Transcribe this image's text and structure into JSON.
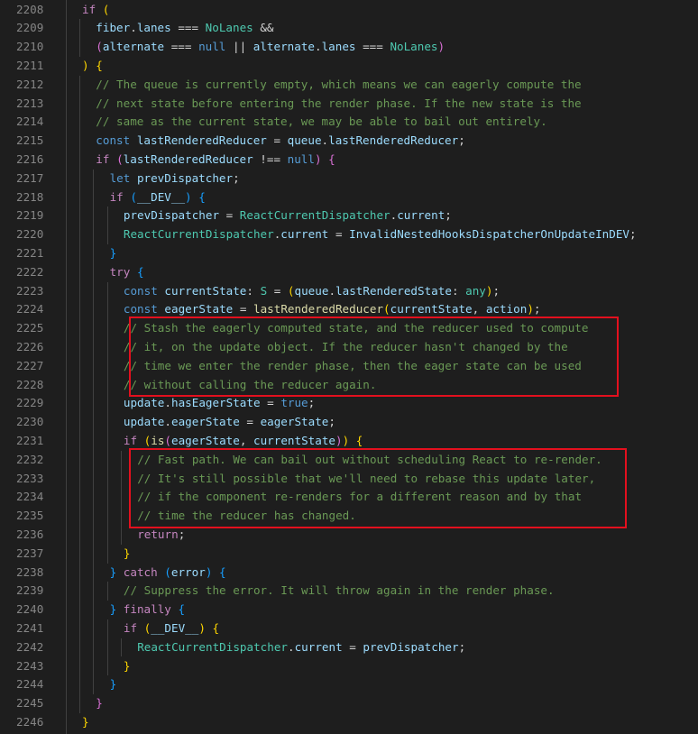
{
  "editor": {
    "colors": {
      "background": "#1e1e1e",
      "line_number": "#858585",
      "highlight_box": "#e3101e"
    },
    "highlight_boxes": [
      {
        "from_line": 2225,
        "to_line": 2228
      },
      {
        "from_line": 2232,
        "to_line": 2235
      }
    ],
    "lines": [
      {
        "n": "2208",
        "indent": 1,
        "tokens": [
          [
            "kw",
            "if"
          ],
          [
            "op",
            " "
          ],
          [
            "b1",
            "("
          ]
        ]
      },
      {
        "n": "2209",
        "indent": 2,
        "tokens": [
          [
            "var",
            "fiber"
          ],
          [
            "op",
            "."
          ],
          [
            "var",
            "lanes"
          ],
          [
            "op",
            " === "
          ],
          [
            "cls",
            "NoLanes"
          ],
          [
            "op",
            " &&"
          ]
        ]
      },
      {
        "n": "2210",
        "indent": 2,
        "tokens": [
          [
            "b2",
            "("
          ],
          [
            "var",
            "alternate"
          ],
          [
            "op",
            " === "
          ],
          [
            "st",
            "null"
          ],
          [
            "op",
            " || "
          ],
          [
            "var",
            "alternate"
          ],
          [
            "op",
            "."
          ],
          [
            "var",
            "lanes"
          ],
          [
            "op",
            " === "
          ],
          [
            "cls",
            "NoLanes"
          ],
          [
            "b2",
            ")"
          ]
        ]
      },
      {
        "n": "2211",
        "indent": 1,
        "tokens": [
          [
            "b1",
            ")"
          ],
          [
            "op",
            " "
          ],
          [
            "b1",
            "{"
          ]
        ]
      },
      {
        "n": "2212",
        "indent": 2,
        "tokens": [
          [
            "com",
            "// The queue is currently empty, which means we can eagerly compute the"
          ]
        ]
      },
      {
        "n": "2213",
        "indent": 2,
        "tokens": [
          [
            "com",
            "// next state before entering the render phase. If the new state is the"
          ]
        ]
      },
      {
        "n": "2214",
        "indent": 2,
        "tokens": [
          [
            "com",
            "// same as the current state, we may be able to bail out entirely."
          ]
        ]
      },
      {
        "n": "2215",
        "indent": 2,
        "tokens": [
          [
            "st",
            "const"
          ],
          [
            "op",
            " "
          ],
          [
            "var",
            "lastRenderedReducer"
          ],
          [
            "op",
            " = "
          ],
          [
            "var",
            "queue"
          ],
          [
            "op",
            "."
          ],
          [
            "var",
            "lastRenderedReducer"
          ],
          [
            "op",
            ";"
          ]
        ]
      },
      {
        "n": "2216",
        "indent": 2,
        "tokens": [
          [
            "kw",
            "if"
          ],
          [
            "op",
            " "
          ],
          [
            "b2",
            "("
          ],
          [
            "var",
            "lastRenderedReducer"
          ],
          [
            "op",
            " !== "
          ],
          [
            "st",
            "null"
          ],
          [
            "b2",
            ")"
          ],
          [
            "op",
            " "
          ],
          [
            "b2",
            "{"
          ]
        ]
      },
      {
        "n": "2217",
        "indent": 3,
        "tokens": [
          [
            "st",
            "let"
          ],
          [
            "op",
            " "
          ],
          [
            "var",
            "prevDispatcher"
          ],
          [
            "op",
            ";"
          ]
        ]
      },
      {
        "n": "2218",
        "indent": 3,
        "tokens": [
          [
            "kw",
            "if"
          ],
          [
            "op",
            " "
          ],
          [
            "b3",
            "("
          ],
          [
            "var",
            "__DEV__"
          ],
          [
            "b3",
            ")"
          ],
          [
            "op",
            " "
          ],
          [
            "b3",
            "{"
          ]
        ]
      },
      {
        "n": "2219",
        "indent": 4,
        "tokens": [
          [
            "var",
            "prevDispatcher"
          ],
          [
            "op",
            " = "
          ],
          [
            "cls",
            "ReactCurrentDispatcher"
          ],
          [
            "op",
            "."
          ],
          [
            "var",
            "current"
          ],
          [
            "op",
            ";"
          ]
        ]
      },
      {
        "n": "2220",
        "indent": 4,
        "tokens": [
          [
            "cls",
            "ReactCurrentDispatcher"
          ],
          [
            "op",
            "."
          ],
          [
            "var",
            "current"
          ],
          [
            "op",
            " = "
          ],
          [
            "var",
            "InvalidNestedHooksDispatcherOnUpdateInDEV"
          ],
          [
            "op",
            ";"
          ]
        ]
      },
      {
        "n": "2221",
        "indent": 3,
        "tokens": [
          [
            "b3",
            "}"
          ]
        ]
      },
      {
        "n": "2222",
        "indent": 3,
        "tokens": [
          [
            "kw",
            "try"
          ],
          [
            "op",
            " "
          ],
          [
            "b3",
            "{"
          ]
        ]
      },
      {
        "n": "2223",
        "indent": 4,
        "tokens": [
          [
            "st",
            "const"
          ],
          [
            "op",
            " "
          ],
          [
            "var",
            "currentState"
          ],
          [
            "op",
            ": "
          ],
          [
            "cls",
            "S"
          ],
          [
            "op",
            " = "
          ],
          [
            "b1",
            "("
          ],
          [
            "var",
            "queue"
          ],
          [
            "op",
            "."
          ],
          [
            "var",
            "lastRenderedState"
          ],
          [
            "op",
            ": "
          ],
          [
            "cls",
            "any"
          ],
          [
            "b1",
            ")"
          ],
          [
            "op",
            ";"
          ]
        ]
      },
      {
        "n": "2224",
        "indent": 4,
        "tokens": [
          [
            "st",
            "const"
          ],
          [
            "op",
            " "
          ],
          [
            "var",
            "eagerState"
          ],
          [
            "op",
            " = "
          ],
          [
            "fn",
            "lastRenderedReducer"
          ],
          [
            "b1",
            "("
          ],
          [
            "var",
            "currentState"
          ],
          [
            "op",
            ", "
          ],
          [
            "var",
            "action"
          ],
          [
            "b1",
            ")"
          ],
          [
            "op",
            ";"
          ]
        ]
      },
      {
        "n": "2225",
        "indent": 4,
        "tokens": [
          [
            "com",
            "// Stash the eagerly computed state, and the reducer used to compute"
          ]
        ]
      },
      {
        "n": "2226",
        "indent": 4,
        "tokens": [
          [
            "com",
            "// it, on the update object. If the reducer hasn't changed by the"
          ]
        ]
      },
      {
        "n": "2227",
        "indent": 4,
        "tokens": [
          [
            "com",
            "// time we enter the render phase, then the eager state can be used"
          ]
        ]
      },
      {
        "n": "2228",
        "indent": 4,
        "tokens": [
          [
            "com",
            "// without calling the reducer again."
          ]
        ]
      },
      {
        "n": "2229",
        "indent": 4,
        "tokens": [
          [
            "var",
            "update"
          ],
          [
            "op",
            "."
          ],
          [
            "var",
            "hasEagerState"
          ],
          [
            "op",
            " = "
          ],
          [
            "st",
            "true"
          ],
          [
            "op",
            ";"
          ]
        ]
      },
      {
        "n": "2230",
        "indent": 4,
        "tokens": [
          [
            "var",
            "update"
          ],
          [
            "op",
            "."
          ],
          [
            "var",
            "eagerState"
          ],
          [
            "op",
            " = "
          ],
          [
            "var",
            "eagerState"
          ],
          [
            "op",
            ";"
          ]
        ]
      },
      {
        "n": "2231",
        "indent": 4,
        "tokens": [
          [
            "kw",
            "if"
          ],
          [
            "op",
            " "
          ],
          [
            "b1",
            "("
          ],
          [
            "fn",
            "is"
          ],
          [
            "b2",
            "("
          ],
          [
            "var",
            "eagerState"
          ],
          [
            "op",
            ", "
          ],
          [
            "var",
            "currentState"
          ],
          [
            "b2",
            ")"
          ],
          [
            "b1",
            ")"
          ],
          [
            "op",
            " "
          ],
          [
            "b1",
            "{"
          ]
        ]
      },
      {
        "n": "2232",
        "indent": 5,
        "tokens": [
          [
            "com",
            "// Fast path. We can bail out without scheduling React to re-render."
          ]
        ]
      },
      {
        "n": "2233",
        "indent": 5,
        "tokens": [
          [
            "com",
            "// It's still possible that we'll need to rebase this update later,"
          ]
        ]
      },
      {
        "n": "2234",
        "indent": 5,
        "tokens": [
          [
            "com",
            "// if the component re-renders for a different reason and by that"
          ]
        ]
      },
      {
        "n": "2235",
        "indent": 5,
        "tokens": [
          [
            "com",
            "// time the reducer has changed."
          ]
        ]
      },
      {
        "n": "2236",
        "indent": 5,
        "tokens": [
          [
            "kw",
            "return"
          ],
          [
            "op",
            ";"
          ]
        ]
      },
      {
        "n": "2237",
        "indent": 4,
        "tokens": [
          [
            "b1",
            "}"
          ]
        ]
      },
      {
        "n": "2238",
        "indent": 3,
        "tokens": [
          [
            "b3",
            "}"
          ],
          [
            "op",
            " "
          ],
          [
            "kw",
            "catch"
          ],
          [
            "op",
            " "
          ],
          [
            "b3",
            "("
          ],
          [
            "var",
            "error"
          ],
          [
            "b3",
            ")"
          ],
          [
            "op",
            " "
          ],
          [
            "b3",
            "{"
          ]
        ]
      },
      {
        "n": "2239",
        "indent": 4,
        "tokens": [
          [
            "com",
            "// Suppress the error. It will throw again in the render phase."
          ]
        ]
      },
      {
        "n": "2240",
        "indent": 3,
        "tokens": [
          [
            "b3",
            "}"
          ],
          [
            "op",
            " "
          ],
          [
            "kw",
            "finally"
          ],
          [
            "op",
            " "
          ],
          [
            "b3",
            "{"
          ]
        ]
      },
      {
        "n": "2241",
        "indent": 4,
        "tokens": [
          [
            "kw",
            "if"
          ],
          [
            "op",
            " "
          ],
          [
            "b1",
            "("
          ],
          [
            "var",
            "__DEV__"
          ],
          [
            "b1",
            ")"
          ],
          [
            "op",
            " "
          ],
          [
            "b1",
            "{"
          ]
        ]
      },
      {
        "n": "2242",
        "indent": 5,
        "tokens": [
          [
            "cls",
            "ReactCurrentDispatcher"
          ],
          [
            "op",
            "."
          ],
          [
            "var",
            "current"
          ],
          [
            "op",
            " = "
          ],
          [
            "var",
            "prevDispatcher"
          ],
          [
            "op",
            ";"
          ]
        ]
      },
      {
        "n": "2243",
        "indent": 4,
        "tokens": [
          [
            "b1",
            "}"
          ]
        ]
      },
      {
        "n": "2244",
        "indent": 3,
        "tokens": [
          [
            "b3",
            "}"
          ]
        ]
      },
      {
        "n": "2245",
        "indent": 2,
        "tokens": [
          [
            "b2",
            "}"
          ]
        ]
      },
      {
        "n": "2246",
        "indent": 1,
        "tokens": [
          [
            "b1",
            "}"
          ]
        ]
      }
    ]
  }
}
